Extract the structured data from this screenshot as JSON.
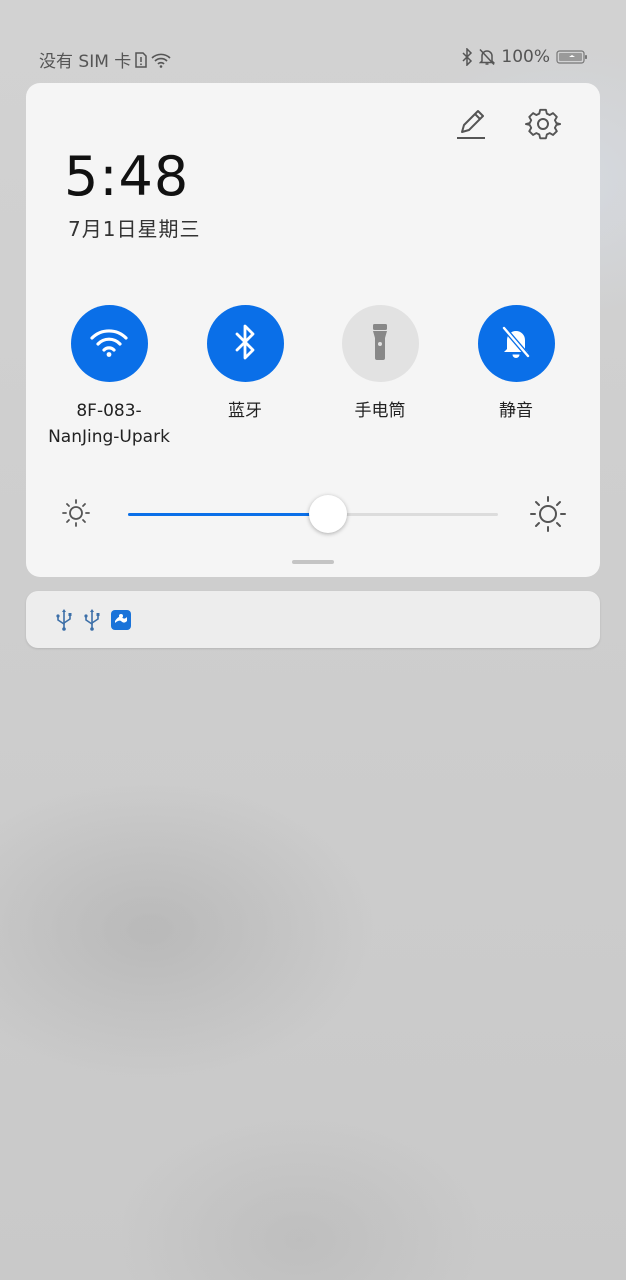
{
  "status_bar": {
    "carrier": "没有 SIM 卡",
    "battery": "100%",
    "icons": [
      "sim-icon",
      "wifi-icon",
      "bluetooth-icon",
      "mute-icon",
      "battery-icon"
    ]
  },
  "panel": {
    "time": "5:48",
    "date": "7月1日星期三",
    "actions": [
      "edit-icon",
      "settings-icon"
    ]
  },
  "tiles": [
    {
      "label_line1": "8F-083-",
      "label_line2": "NanJing-Upark",
      "icon": "wifi-icon",
      "active": true
    },
    {
      "label_line1": "蓝牙",
      "label_line2": "",
      "icon": "bluetooth-icon",
      "active": true
    },
    {
      "label_line1": "手电筒",
      "label_line2": "",
      "icon": "flashlight-icon",
      "active": false
    },
    {
      "label_line1": "静音",
      "label_line2": "",
      "icon": "mute-icon",
      "active": true
    }
  ],
  "brightness": {
    "level": 0.54
  },
  "notification_icons": [
    "usb-icon",
    "usb-icon",
    "app-icon"
  ],
  "colors": {
    "accent": "#0a6fe8",
    "inactive": "#e2e2e2"
  }
}
